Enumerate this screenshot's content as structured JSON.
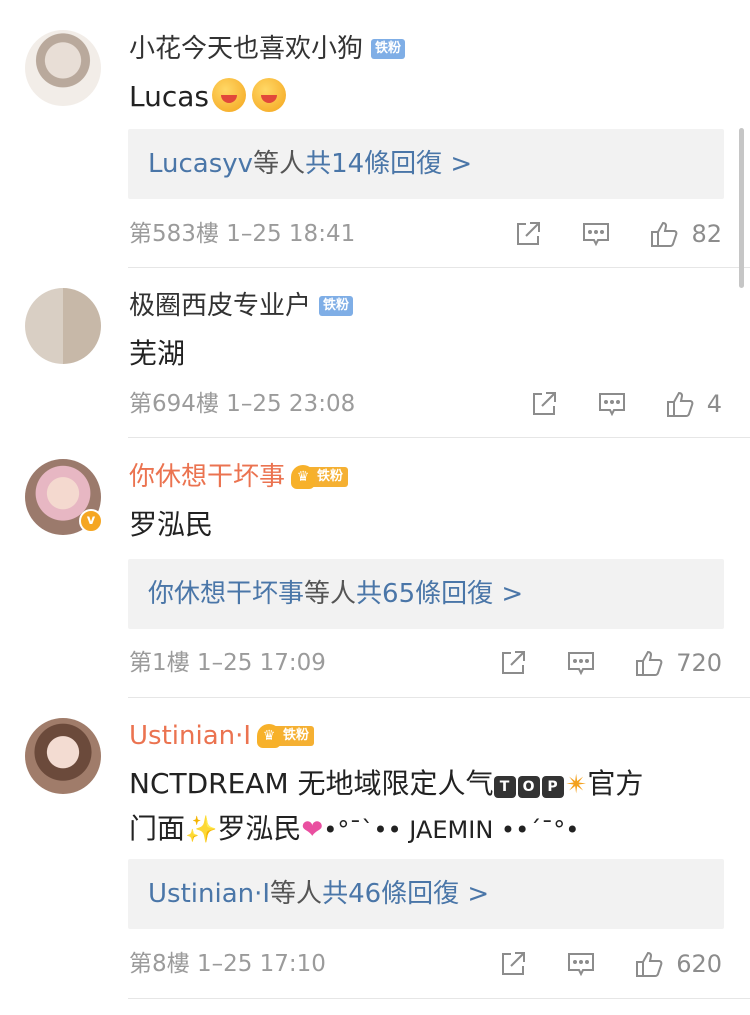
{
  "comments": [
    {
      "username": "小花今天也喜欢小狗",
      "badge": "铁粉",
      "content_text": "Lucas",
      "reply_user": "Lucasyv",
      "reply_mid": "等人",
      "reply_count_text": "共14條回復 >",
      "floor_time": "第583樓 1–25 18:41",
      "likes": "82"
    },
    {
      "username": "极圈西皮专业户",
      "badge": "铁粉",
      "content_text": "芜湖",
      "floor_time": "第694樓 1–25 23:08",
      "likes": "4"
    },
    {
      "username": "你休想干坏事",
      "badge": "铁粉",
      "content_text": "罗泓民",
      "reply_user": "你休想干坏事",
      "reply_mid": "等人",
      "reply_count_text": "共65條回復 >",
      "floor_time": "第1樓 1–25 17:09",
      "likes": "720"
    },
    {
      "username": "Ustinian·I",
      "badge": "铁粉",
      "content_line1_a": "NCTDREAM 无地域限定人气",
      "content_tiles": [
        "T",
        "O",
        "P"
      ],
      "content_line1_b": "官方",
      "content_line2_a": "门面",
      "content_line2_b": "罗泓民",
      "content_line2_c": "•°¯`•• JAEMIN ••´¯°•",
      "reply_user": "Ustinian·I",
      "reply_mid": "等人",
      "reply_count_text": "共46條回復 >",
      "floor_time": "第8樓 1–25 17:10",
      "likes": "620"
    }
  ],
  "icons": {
    "share": "share-icon",
    "comment": "comment-icon",
    "like": "thumbs-up-icon"
  },
  "colors": {
    "link": "#4a76a8",
    "vip_name": "#eb7350",
    "fan_badge": "#7faee6",
    "vip_badge": "#f5b032"
  }
}
